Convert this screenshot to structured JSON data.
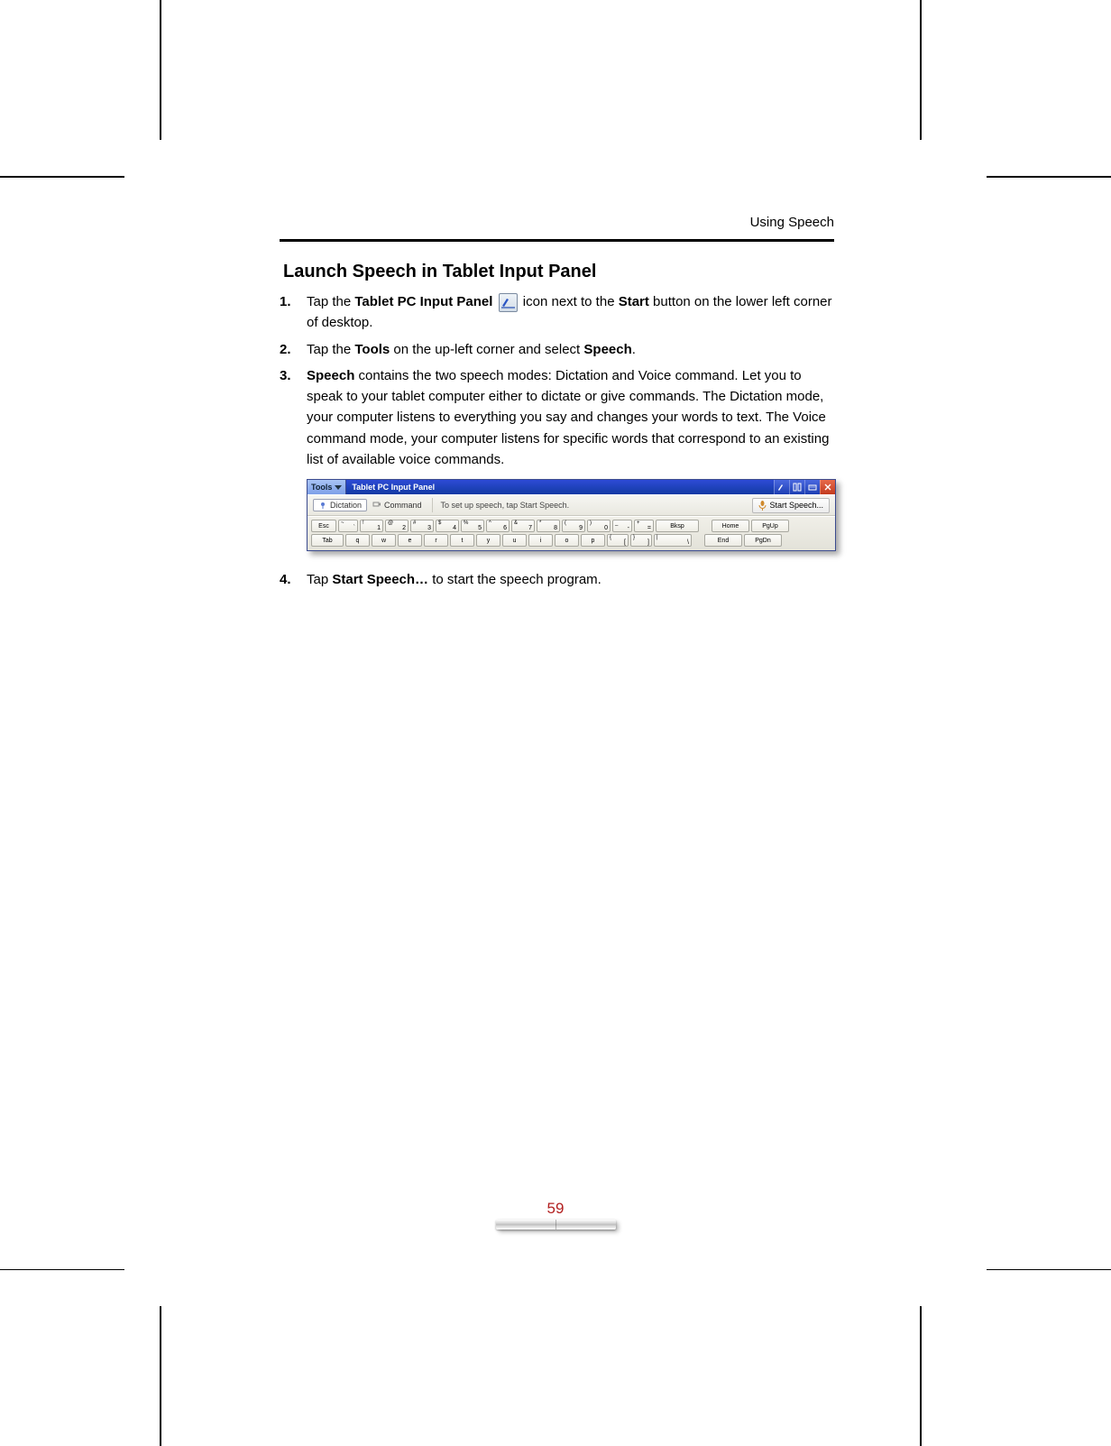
{
  "running_head": "Using Speech",
  "heading": "Launch Speech in Tablet Input Panel",
  "steps": {
    "n1": "1.",
    "s1a": "Tap the ",
    "s1_b1": "Tablet PC Input Panel",
    "s1b": " icon next to the ",
    "s1_b2": "Start",
    "s1c": " button on the lower left corner of desktop.",
    "n2": "2.",
    "s2a": "Tap the ",
    "s2_b1": "Tools",
    "s2b": " on the up-left corner and select ",
    "s2_b2": "Speech",
    "s2c": ".",
    "n3": "3.",
    "s3_b1": "Speech",
    "s3a": " contains the two speech modes: Dictation and Voice command. Let you to speak to your tablet computer either to dictate or give commands. The Dictation mode, your computer listens to everything you say and changes your words to text. The Voice command mode, your computer listens for specific words that correspond to an existing list of available voice commands.",
    "n4": "4.",
    "s4a": "Tap ",
    "s4_b1": "Start Speech…",
    "s4b": " to start the speech program."
  },
  "panel": {
    "tools_label": "Tools",
    "title": "Tablet PC Input Panel",
    "dictation": "Dictation",
    "command": "Command",
    "hint": "To set up speech, tap Start Speech.",
    "start_label": "Start Speech...",
    "row1": {
      "esc": "Esc",
      "tilde_sup": "~",
      "tilde_sub": "`",
      "k1s": "!",
      "k1": "1",
      "k2s": "@",
      "k2": "2",
      "k3s": "#",
      "k3": "3",
      "k4s": "$",
      "k4": "4",
      "k5s": "%",
      "k5": "5",
      "k6s": "^",
      "k6": "6",
      "k7s": "&",
      "k7": "7",
      "k8s": "*",
      "k8": "8",
      "k9s": "(",
      "k9": "9",
      "k0s": ")",
      "k0": "0",
      "kmins": "_",
      "kmin": "-",
      "keqs": "+",
      "keq": "=",
      "bksp": "Bksp",
      "home": "Home",
      "pgup": "PgUp"
    },
    "row2": {
      "tab": "Tab",
      "q": "q",
      "w": "w",
      "e": "e",
      "r": "r",
      "t": "t",
      "y": "y",
      "u": "u",
      "i": "i",
      "o": "o",
      "p": "p",
      "lb_s": "{",
      "lb": "[",
      "rb_s": "}",
      "rb": "]",
      "bs_s": "|",
      "bs": "\\",
      "end": "End",
      "pgdn": "PgDn"
    }
  },
  "page_number": "59"
}
